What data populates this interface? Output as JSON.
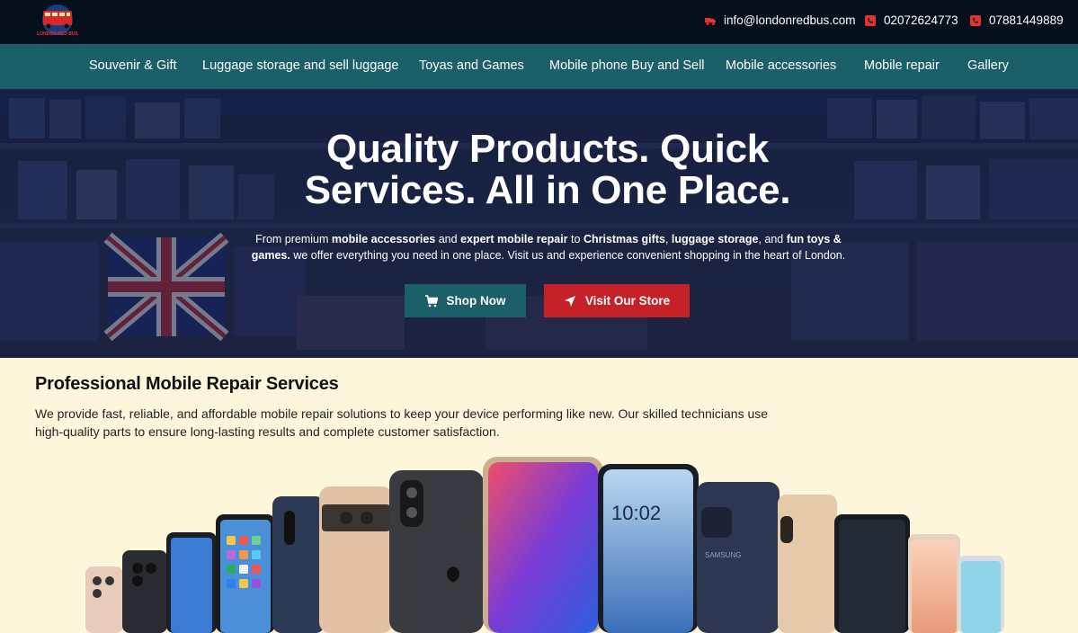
{
  "brand": {
    "logo_text": "LONDON RED BUS",
    "logo_icon": "red-bus-logo"
  },
  "contacts": {
    "email": "info@londonredbus.com",
    "phone1": "02072624773",
    "phone2": "07881449889"
  },
  "nav": {
    "items": [
      {
        "label": "Souvenir & Gift"
      },
      {
        "label": "Luggage storage and sell luggage"
      },
      {
        "label": "Toyas and Games"
      },
      {
        "label": "Mobile phone Buy and Sell"
      },
      {
        "label": "Mobile accessories"
      },
      {
        "label": "Mobile repair"
      },
      {
        "label": "Gallery"
      }
    ]
  },
  "hero": {
    "title": "Quality Products. Quick Services. All in One Place.",
    "desc": {
      "p1": "From premium ",
      "b1": "mobile accessories",
      "p2": " and ",
      "b2": "expert mobile repair",
      "p3": " to ",
      "b3": "Christmas gifts",
      "p4": ", ",
      "b4": "luggage storage",
      "p5": ", and ",
      "b5": "fun toys & games.",
      "p6": " we offer everything you need in one place. Visit us and experience convenient shopping in the heart of London."
    },
    "shop_button": "Shop Now",
    "visit_button": "Visit Our Store"
  },
  "section": {
    "title": "Professional Mobile Repair Services",
    "text": "We provide fast, reliable, and affordable mobile repair solutions to keep your device performing like new. Our skilled technicians use high-quality parts to ensure long-lasting results and complete customer satisfaction."
  },
  "phones_image": {
    "time_text": "10:02",
    "brand_samsung": "SAMSUNG",
    "icon": "phones-lineup-image"
  },
  "colors": {
    "topbar": "#05101c",
    "nav": "#1b5f69",
    "accent_red": "#c42228",
    "section_bg": "#fef6da"
  }
}
